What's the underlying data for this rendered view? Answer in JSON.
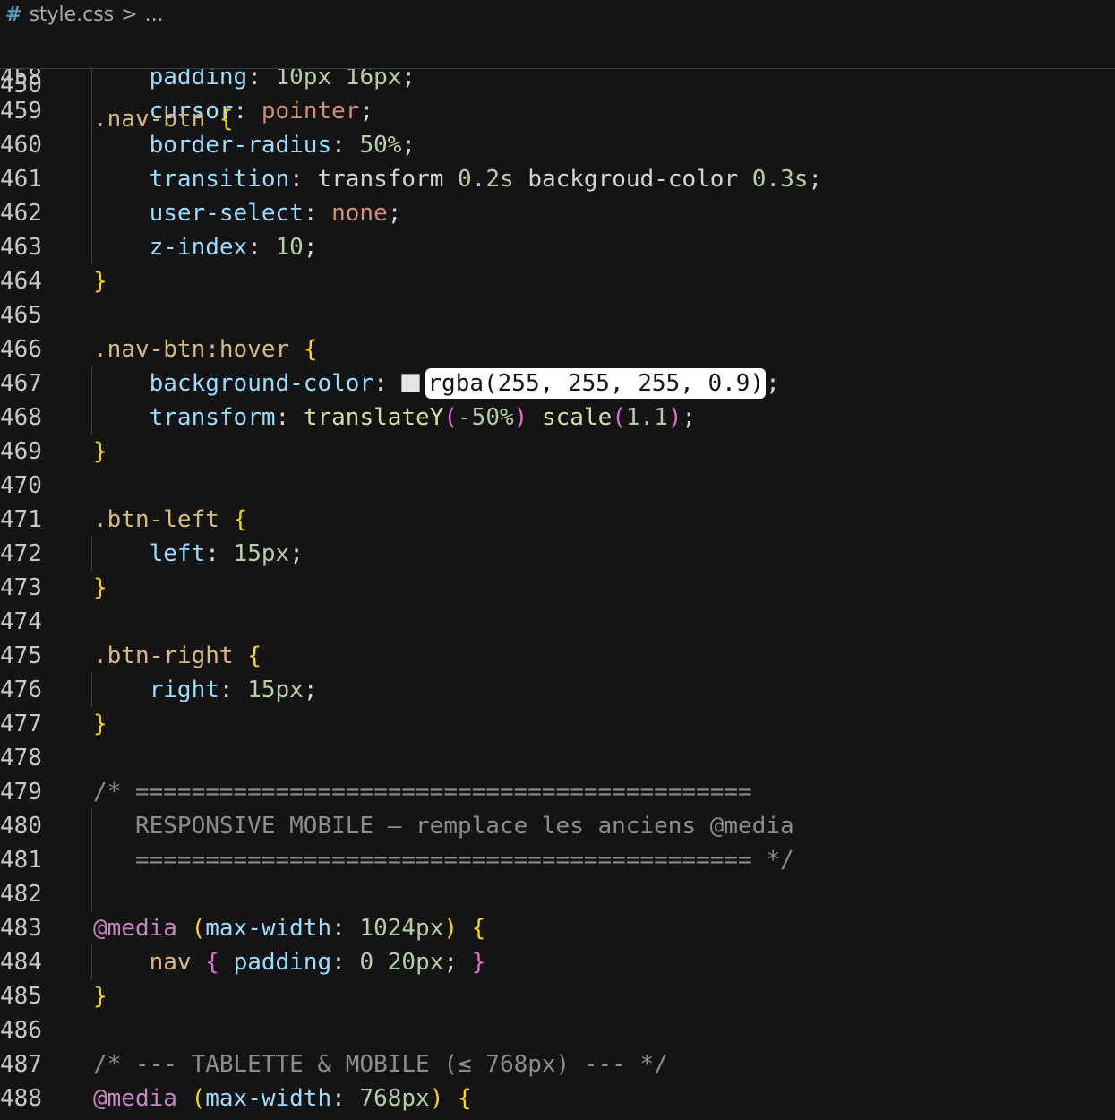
{
  "breadcrumb": {
    "icon": "#",
    "file": "style.css",
    "separator": ">",
    "more": "..."
  },
  "sticky": {
    "line_number": "450",
    "selector": ".nav-btn",
    "brace": "{"
  },
  "lines": [
    {
      "n": "458",
      "guide": true,
      "tokens": [
        {
          "t": "    ",
          "c": "plain"
        },
        {
          "t": "padding",
          "c": "prop"
        },
        {
          "t": ": ",
          "c": "punct"
        },
        {
          "t": "10px",
          "c": "num"
        },
        {
          "t": " ",
          "c": "plain"
        },
        {
          "t": "16px",
          "c": "num"
        },
        {
          "t": ";",
          "c": "punct"
        }
      ]
    },
    {
      "n": "459",
      "guide": true,
      "tokens": [
        {
          "t": "    ",
          "c": "plain"
        },
        {
          "t": "cursor",
          "c": "prop"
        },
        {
          "t": ": ",
          "c": "punct"
        },
        {
          "t": "pointer",
          "c": "kw"
        },
        {
          "t": ";",
          "c": "punct"
        }
      ]
    },
    {
      "n": "460",
      "guide": true,
      "tokens": [
        {
          "t": "    ",
          "c": "plain"
        },
        {
          "t": "border-radius",
          "c": "prop"
        },
        {
          "t": ": ",
          "c": "punct"
        },
        {
          "t": "50%",
          "c": "num"
        },
        {
          "t": ";",
          "c": "punct"
        }
      ]
    },
    {
      "n": "461",
      "guide": true,
      "tokens": [
        {
          "t": "    ",
          "c": "plain"
        },
        {
          "t": "transition",
          "c": "prop"
        },
        {
          "t": ": ",
          "c": "punct"
        },
        {
          "t": "transform",
          "c": "plain"
        },
        {
          "t": " ",
          "c": "plain"
        },
        {
          "t": "0.2s",
          "c": "num"
        },
        {
          "t": " ",
          "c": "plain"
        },
        {
          "t": "backgroud-color",
          "c": "plain"
        },
        {
          "t": " ",
          "c": "plain"
        },
        {
          "t": "0.3s",
          "c": "num"
        },
        {
          "t": ";",
          "c": "punct"
        }
      ]
    },
    {
      "n": "462",
      "guide": true,
      "tokens": [
        {
          "t": "    ",
          "c": "plain"
        },
        {
          "t": "user-select",
          "c": "prop"
        },
        {
          "t": ": ",
          "c": "punct"
        },
        {
          "t": "none",
          "c": "kw"
        },
        {
          "t": ";",
          "c": "punct"
        }
      ]
    },
    {
      "n": "463",
      "guide": true,
      "tokens": [
        {
          "t": "    ",
          "c": "plain"
        },
        {
          "t": "z-index",
          "c": "prop"
        },
        {
          "t": ": ",
          "c": "punct"
        },
        {
          "t": "10",
          "c": "num"
        },
        {
          "t": ";",
          "c": "punct"
        }
      ]
    },
    {
      "n": "464",
      "guide": false,
      "tokens": [
        {
          "t": "}",
          "c": "brace"
        }
      ]
    },
    {
      "n": "465",
      "guide": false,
      "tokens": []
    },
    {
      "n": "466",
      "guide": false,
      "tokens": [
        {
          "t": ".nav-btn:hover",
          "c": "sel"
        },
        {
          "t": " ",
          "c": "plain"
        },
        {
          "t": "{",
          "c": "brace"
        }
      ]
    },
    {
      "n": "467",
      "guide": true,
      "tokens": [
        {
          "t": "    ",
          "c": "plain"
        },
        {
          "t": "background-color",
          "c": "prop"
        },
        {
          "t": ": ",
          "c": "punct"
        },
        {
          "swatch": "#e6e6e6"
        },
        {
          "t": "rgba(255, 255, 255, 0.9)",
          "c": "hl"
        },
        {
          "t": ";",
          "c": "punct"
        }
      ]
    },
    {
      "n": "468",
      "guide": true,
      "tokens": [
        {
          "t": "    ",
          "c": "plain"
        },
        {
          "t": "transform",
          "c": "prop"
        },
        {
          "t": ": ",
          "c": "punct"
        },
        {
          "t": "translateY",
          "c": "func"
        },
        {
          "t": "(",
          "c": "paren"
        },
        {
          "t": "-50%",
          "c": "num"
        },
        {
          "t": ")",
          "c": "paren"
        },
        {
          "t": " ",
          "c": "plain"
        },
        {
          "t": "scale",
          "c": "func"
        },
        {
          "t": "(",
          "c": "paren"
        },
        {
          "t": "1.1",
          "c": "num"
        },
        {
          "t": ")",
          "c": "paren"
        },
        {
          "t": ";",
          "c": "punct"
        }
      ]
    },
    {
      "n": "469",
      "guide": false,
      "tokens": [
        {
          "t": "}",
          "c": "brace"
        }
      ]
    },
    {
      "n": "470",
      "guide": false,
      "tokens": []
    },
    {
      "n": "471",
      "guide": false,
      "tokens": [
        {
          "t": ".btn-left",
          "c": "sel"
        },
        {
          "t": " ",
          "c": "plain"
        },
        {
          "t": "{",
          "c": "brace"
        }
      ]
    },
    {
      "n": "472",
      "guide": true,
      "tokens": [
        {
          "t": "    ",
          "c": "plain"
        },
        {
          "t": "left",
          "c": "prop"
        },
        {
          "t": ": ",
          "c": "punct"
        },
        {
          "t": "15px",
          "c": "num"
        },
        {
          "t": ";",
          "c": "punct"
        }
      ]
    },
    {
      "n": "473",
      "guide": false,
      "tokens": [
        {
          "t": "}",
          "c": "brace"
        }
      ]
    },
    {
      "n": "474",
      "guide": false,
      "tokens": []
    },
    {
      "n": "475",
      "guide": false,
      "tokens": [
        {
          "t": ".btn-right",
          "c": "sel"
        },
        {
          "t": " ",
          "c": "plain"
        },
        {
          "t": "{",
          "c": "brace"
        }
      ]
    },
    {
      "n": "476",
      "guide": true,
      "tokens": [
        {
          "t": "    ",
          "c": "plain"
        },
        {
          "t": "right",
          "c": "prop"
        },
        {
          "t": ": ",
          "c": "punct"
        },
        {
          "t": "15px",
          "c": "num"
        },
        {
          "t": ";",
          "c": "punct"
        }
      ]
    },
    {
      "n": "477",
      "guide": false,
      "tokens": [
        {
          "t": "}",
          "c": "brace"
        }
      ]
    },
    {
      "n": "478",
      "guide": false,
      "tokens": []
    },
    {
      "n": "479",
      "guide": false,
      "tokens": [
        {
          "t": "/* ============================================",
          "c": "comment"
        }
      ]
    },
    {
      "n": "480",
      "guide": true,
      "tokens": [
        {
          "t": "   RESPONSIVE MOBILE — remplace les anciens @media",
          "c": "comment"
        }
      ]
    },
    {
      "n": "481",
      "guide": true,
      "tokens": [
        {
          "t": "   ============================================ */",
          "c": "comment"
        }
      ]
    },
    {
      "n": "482",
      "guide": true,
      "tokens": []
    },
    {
      "n": "483",
      "guide": false,
      "tokens": [
        {
          "t": "@media",
          "c": "at"
        },
        {
          "t": " ",
          "c": "plain"
        },
        {
          "t": "(",
          "c": "brace"
        },
        {
          "t": "max-width",
          "c": "prop"
        },
        {
          "t": ": ",
          "c": "punct"
        },
        {
          "t": "1024px",
          "c": "num"
        },
        {
          "t": ")",
          "c": "brace"
        },
        {
          "t": " ",
          "c": "plain"
        },
        {
          "t": "{",
          "c": "brace"
        }
      ]
    },
    {
      "n": "484",
      "guide": true,
      "tokens": [
        {
          "t": "    ",
          "c": "plain"
        },
        {
          "t": "nav",
          "c": "sel"
        },
        {
          "t": " ",
          "c": "plain"
        },
        {
          "t": "{",
          "c": "paren"
        },
        {
          "t": " ",
          "c": "plain"
        },
        {
          "t": "padding",
          "c": "prop"
        },
        {
          "t": ": ",
          "c": "punct"
        },
        {
          "t": "0",
          "c": "num"
        },
        {
          "t": " ",
          "c": "plain"
        },
        {
          "t": "20px",
          "c": "num"
        },
        {
          "t": "; ",
          "c": "punct"
        },
        {
          "t": "}",
          "c": "paren"
        }
      ]
    },
    {
      "n": "485",
      "guide": false,
      "tokens": [
        {
          "t": "}",
          "c": "brace"
        }
      ]
    },
    {
      "n": "486",
      "guide": false,
      "tokens": []
    },
    {
      "n": "487",
      "guide": false,
      "tokens": [
        {
          "t": "/* --- TABLETTE & MOBILE (≤ 768px) --- */",
          "c": "comment"
        }
      ]
    },
    {
      "n": "488",
      "guide": false,
      "tokens": [
        {
          "t": "@media",
          "c": "at"
        },
        {
          "t": " ",
          "c": "plain"
        },
        {
          "t": "(",
          "c": "brace"
        },
        {
          "t": "max-width",
          "c": "prop"
        },
        {
          "t": ": ",
          "c": "punct"
        },
        {
          "t": "768px",
          "c": "num"
        },
        {
          "t": ")",
          "c": "brace"
        },
        {
          "t": " ",
          "c": "plain"
        },
        {
          "t": "{",
          "c": "brace"
        }
      ]
    }
  ],
  "colors": {
    "background": "#141414",
    "selector": "#d7ba7d",
    "property": "#9cdcfe",
    "number": "#b5cea8",
    "keyword": "#ce9178",
    "function": "#dcdcaa",
    "comment": "#8c8c8c",
    "brace": "#ffd700",
    "at_rule": "#c586c0"
  }
}
